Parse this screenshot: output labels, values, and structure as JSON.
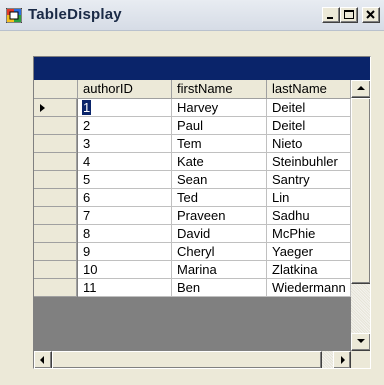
{
  "window": {
    "title": "TableDisplay",
    "minimize_glyph": "_",
    "maximize_glyph": "□",
    "close_glyph": "×"
  },
  "grid": {
    "caption": "",
    "columns": [
      "authorID",
      "firstName",
      "lastName"
    ],
    "current_row_index": 0,
    "rows": [
      [
        "1",
        "Harvey",
        "Deitel"
      ],
      [
        "2",
        "Paul",
        "Deitel"
      ],
      [
        "3",
        "Tem",
        "Nieto"
      ],
      [
        "4",
        "Kate",
        "Steinbuhler"
      ],
      [
        "5",
        "Sean",
        "Santry"
      ],
      [
        "6",
        "Ted",
        "Lin"
      ],
      [
        "7",
        "Praveen",
        "Sadhu"
      ],
      [
        "8",
        "David",
        "McPhie"
      ],
      [
        "9",
        "Cheryl",
        "Yaeger"
      ],
      [
        "10",
        "Marina",
        "Zlatkina"
      ],
      [
        "11",
        "Ben",
        "Wiedermann"
      ]
    ]
  },
  "colors": {
    "caption_bar": "#0a246a",
    "window_face": "#ece9d8",
    "grid_background": "#808080"
  },
  "icons": {
    "app": "datagrid-app-icon",
    "row_pointer": "row-pointer-arrow-icon"
  }
}
